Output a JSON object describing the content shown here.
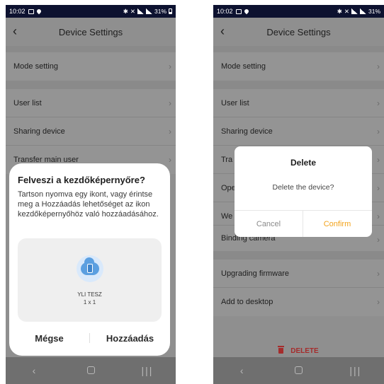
{
  "left": {
    "status": {
      "time": "10:02",
      "battery": "31%"
    },
    "header": {
      "title": "Device Settings"
    },
    "rows": [
      "Mode setting",
      "User list",
      "Sharing device",
      "Transfer main user"
    ],
    "sheet": {
      "title": "Felveszi a kezdőképernyőre?",
      "desc": "Tartson nyomva egy ikont, vagy érintse meg a Hozzáadás lehetőséget az ikon kezdőképernyőhöz való hozzáadásához.",
      "app_name": "YLI TESZ",
      "app_size": "1 x 1",
      "cancel": "Mégse",
      "add": "Hozzáadás"
    }
  },
  "right": {
    "status": {
      "time": "10:02",
      "battery": "31%"
    },
    "header": {
      "title": "Device Settings"
    },
    "rows": [
      "Mode setting",
      "User list",
      "Sharing device",
      "Tra",
      "Ope",
      "We",
      "Binding camera",
      "Upgrading firmware",
      "Add to desktop"
    ],
    "dialog": {
      "title": "Delete",
      "message": "Delete the device?",
      "cancel": "Cancel",
      "confirm": "Confirm"
    },
    "delete": "DELETE"
  },
  "colors": {
    "confirm": "#f2a31b",
    "delete": "#a52c2c",
    "statusbar": "#0d1230"
  },
  "icons": [
    "back-arrow-icon",
    "chevron-right-icon",
    "cloud-phone-icon",
    "trash-icon"
  ]
}
